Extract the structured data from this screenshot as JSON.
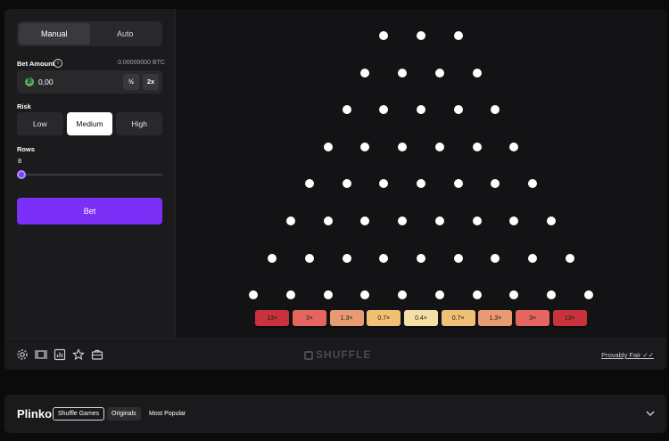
{
  "mode_tabs": [
    {
      "label": "Manual",
      "active": true
    },
    {
      "label": "Auto",
      "active": false
    }
  ],
  "bet": {
    "label": "Bet Amount",
    "info_icon": "info-icon",
    "balance": "0.00000000 BTC",
    "value": "0,00",
    "coin_icon": "bitcoin-coin-icon",
    "half_label": "½",
    "double_label": "2x"
  },
  "risk": {
    "label": "Risk",
    "options": [
      "Low",
      "Medium",
      "High"
    ],
    "selected": "Medium"
  },
  "rows": {
    "label": "Rows",
    "value": "8",
    "slider_fraction": 0
  },
  "bet_button": "Bet",
  "board": {
    "peg_rows": [
      3,
      4,
      5,
      6,
      7,
      8,
      9,
      10
    ],
    "peg_color": "#ffffff"
  },
  "multipliers": [
    {
      "label": "13×",
      "color": "#c8323c"
    },
    {
      "label": "3×",
      "color": "#e5655f"
    },
    {
      "label": "1.3×",
      "color": "#e89a72"
    },
    {
      "label": "0.7×",
      "color": "#f0c074"
    },
    {
      "label": "0.4×",
      "color": "#f4dfa7"
    },
    {
      "label": "0.7×",
      "color": "#f0c074"
    },
    {
      "label": "1.3×",
      "color": "#e89a72"
    },
    {
      "label": "3×",
      "color": "#e5655f"
    },
    {
      "label": "13×",
      "color": "#c8323c"
    }
  ],
  "footer": {
    "icons": [
      "settings-icon",
      "theatre-mode-icon",
      "stats-icon",
      "favorite-star-icon",
      "fairness-briefcase-icon"
    ],
    "brand": "SHUFFLE",
    "provably_fair": "Provably Fair"
  },
  "info_bar": {
    "title": "Plinko",
    "tags": [
      "Shuffle Games",
      "Originals",
      "Most Popular"
    ],
    "expand_icon": "chevron-down-icon"
  },
  "colors": {
    "accent": "#7b2ff7",
    "background": "#0b0b0c",
    "panel": "#1a1a1c"
  }
}
